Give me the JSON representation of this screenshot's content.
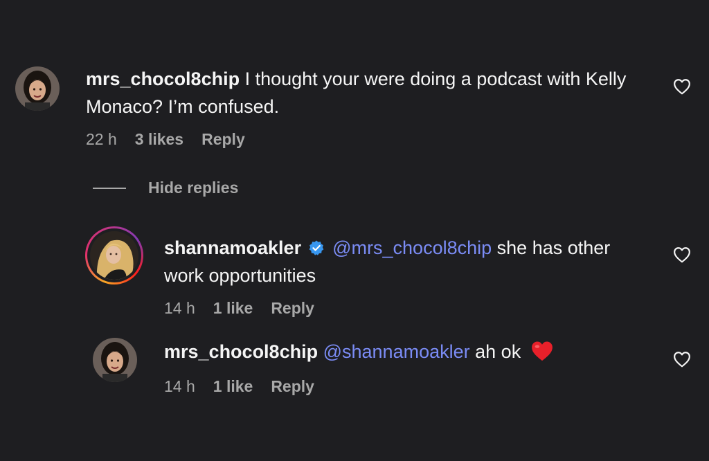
{
  "comments": [
    {
      "username": "mrs_chocol8chip",
      "text": "I thought your were doing a podcast with Kelly Monaco? I’m confused.",
      "time": "22 h",
      "likes": "3 likes",
      "reply_label": "Reply",
      "avatar_icon": "user-avatar-woman",
      "like_icon": "heart-outline-icon"
    }
  ],
  "hide_replies_label": "Hide replies",
  "replies": [
    {
      "username": "shannamoakler",
      "verified": true,
      "mention": "@mrs_chocol8chip",
      "text": "she has other work opportunities",
      "time": "14 h",
      "likes": "1 like",
      "reply_label": "Reply",
      "avatar_icon": "user-avatar-story-ring",
      "like_icon": "heart-outline-icon"
    },
    {
      "username": "mrs_chocol8chip",
      "verified": false,
      "mention": "@shannamoakler",
      "text": "ah ok",
      "emoji": "red-heart-emoji",
      "time": "14 h",
      "likes": "1 like",
      "reply_label": "Reply",
      "avatar_icon": "user-avatar-woman",
      "like_icon": "heart-outline-icon"
    }
  ],
  "colors": {
    "background": "#1e1e21",
    "text": "#f5f5f5",
    "meta": "#a8a8a8",
    "mention": "#7b8cf5",
    "verified": "#3897f0",
    "emoji_heart": "#e8202a"
  }
}
